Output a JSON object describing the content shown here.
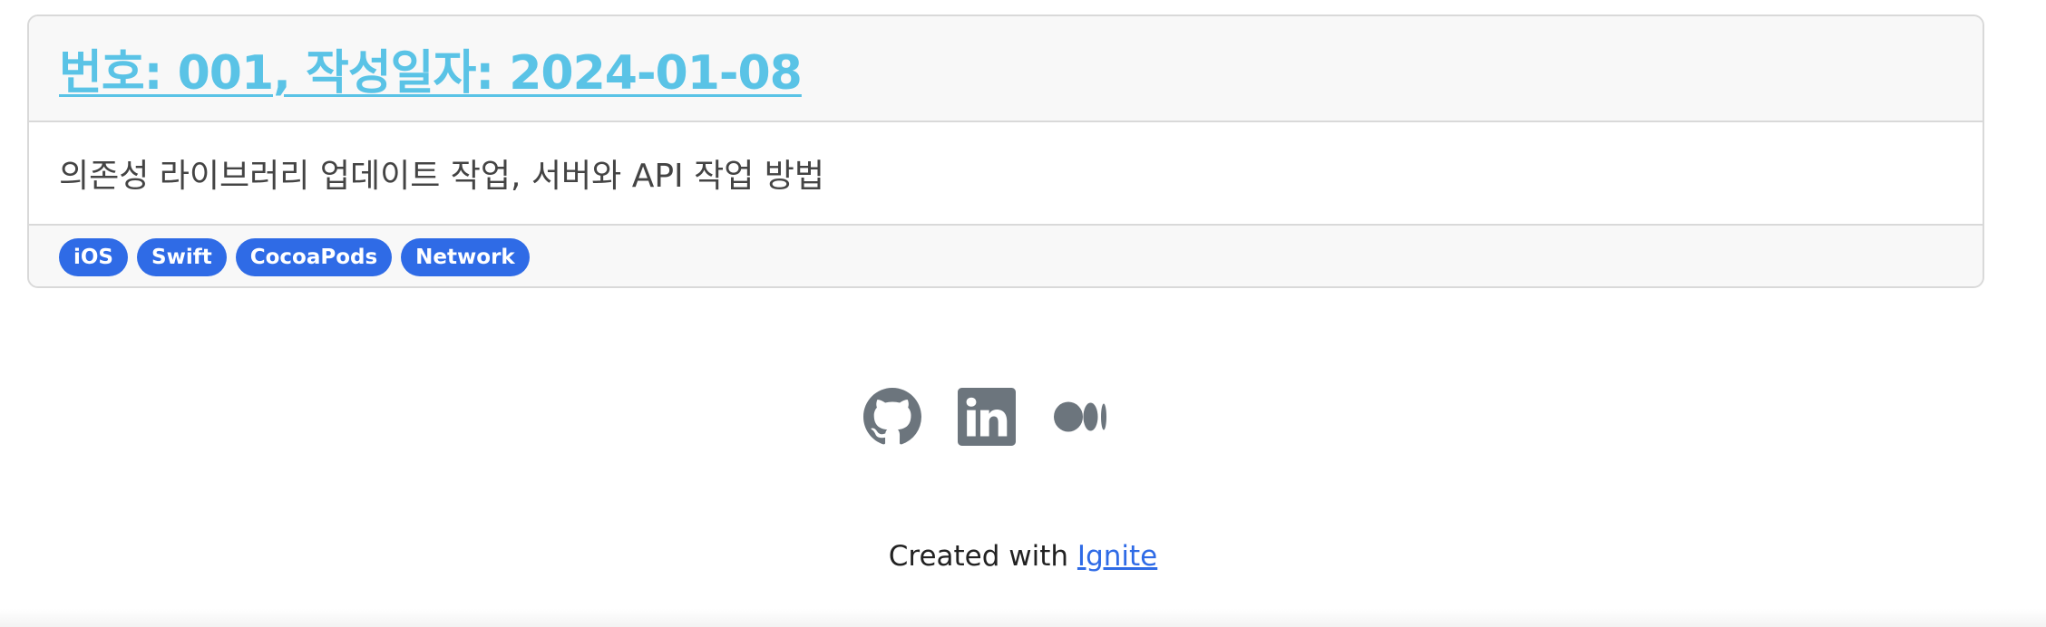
{
  "post": {
    "title": "번호: 001, 작성일자: 2024-01-08",
    "description": "의존성 라이브러리 업데이트 작업, 서버와 API 작업 방법",
    "tags": [
      "iOS",
      "Swift",
      "CocoaPods",
      "Network"
    ]
  },
  "social": {
    "icons": [
      "github-icon",
      "linkedin-icon",
      "medium-icon"
    ],
    "icon_color": "#6c757d"
  },
  "footer": {
    "prefix": "Created with ",
    "link_label": "Ignite"
  },
  "colors": {
    "title": "#5ac3e6",
    "tag_bg": "#2f6be6",
    "link": "#2f6be6"
  }
}
